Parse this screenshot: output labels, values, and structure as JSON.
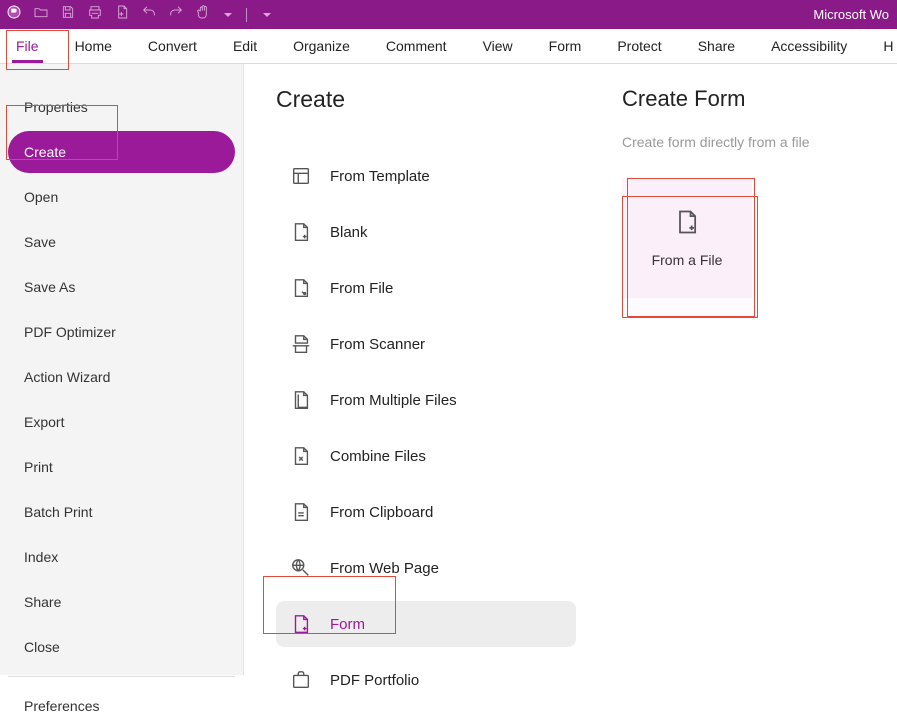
{
  "titlebar": {
    "title": "Microsoft Wo"
  },
  "ribbon": {
    "tabs": [
      "File",
      "Home",
      "Convert",
      "Edit",
      "Organize",
      "Comment",
      "View",
      "Form",
      "Protect",
      "Share",
      "Accessibility",
      "H"
    ],
    "active": "File"
  },
  "sidebar": {
    "items": [
      "Properties",
      "Create",
      "Open",
      "Save",
      "Save As",
      "PDF Optimizer",
      "Action Wizard",
      "Export",
      "Print",
      "Batch Print",
      "Index",
      "Share",
      "Close"
    ],
    "below_separator": [
      "Preferences"
    ],
    "active": "Create"
  },
  "center": {
    "title": "Create",
    "items": [
      {
        "label": "From Template",
        "icon": "template"
      },
      {
        "label": "Blank",
        "icon": "blank"
      },
      {
        "label": "From File",
        "icon": "fromfile"
      },
      {
        "label": "From Scanner",
        "icon": "scanner"
      },
      {
        "label": "From Multiple Files",
        "icon": "multiple"
      },
      {
        "label": "Combine Files",
        "icon": "combine"
      },
      {
        "label": "From Clipboard",
        "icon": "clipboard"
      },
      {
        "label": "From Web Page",
        "icon": "web"
      },
      {
        "label": "Form",
        "icon": "form"
      },
      {
        "label": "PDF Portfolio",
        "icon": "portfolio"
      }
    ],
    "selected": "Form"
  },
  "right": {
    "title": "Create Form",
    "subtitle": "Create form directly from a file",
    "box_label": "From a File"
  }
}
